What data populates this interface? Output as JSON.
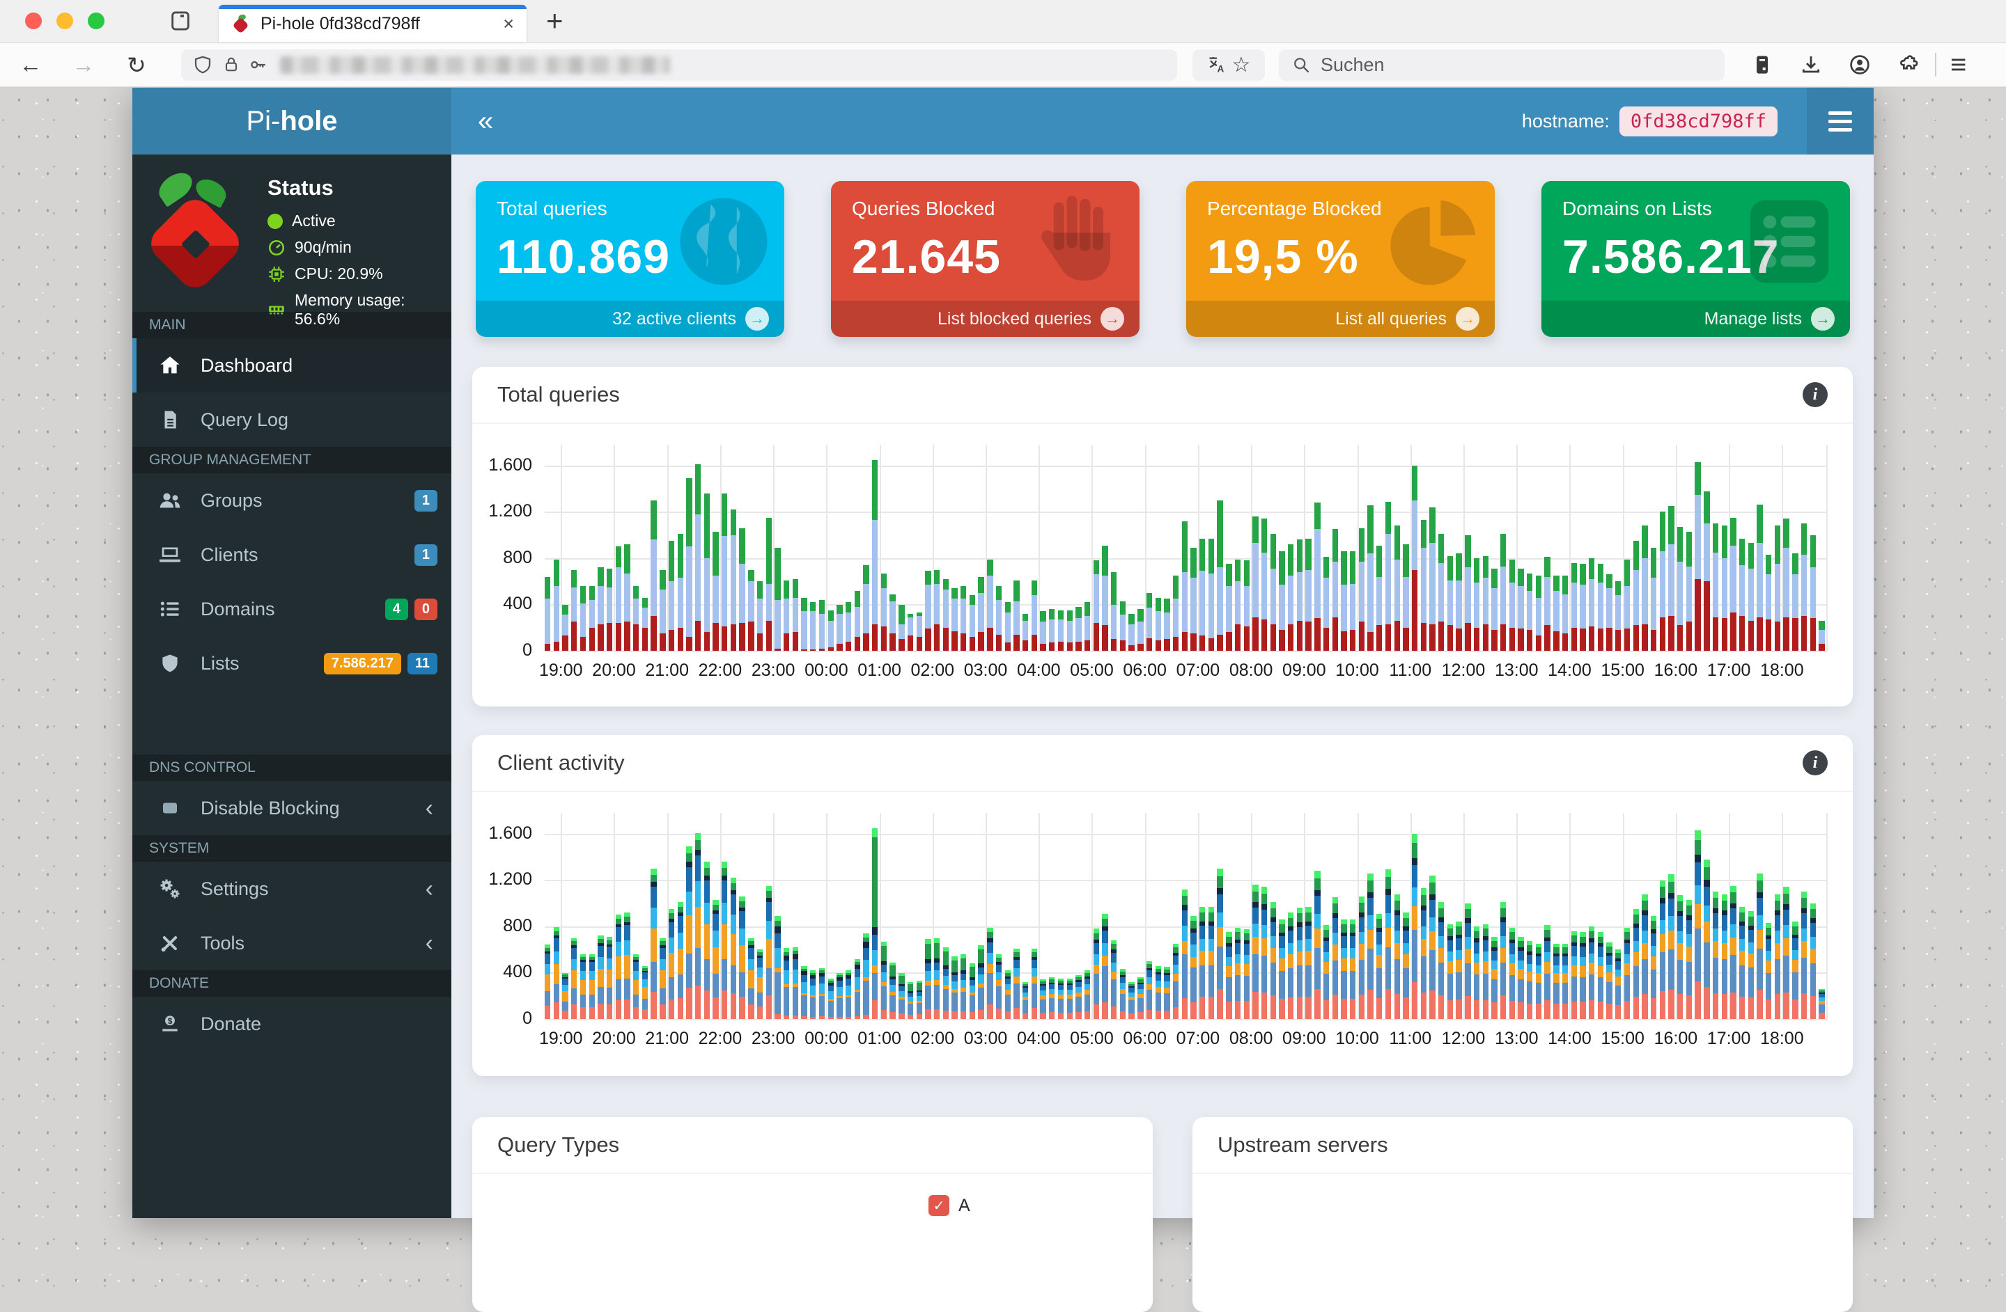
{
  "browser": {
    "tab_title": "Pi-hole 0fd38cd798ff",
    "search_placeholder": "Suchen",
    "icons": {
      "back": "←",
      "forward": "→",
      "reload": "↻",
      "star": "☆",
      "close": "×",
      "new_tab": "+",
      "menu": "≡"
    }
  },
  "header": {
    "brand_light": "Pi-",
    "brand_bold": "hole",
    "collapse": "«",
    "hostname_label": "hostname:",
    "hostname": "0fd38cd798ff"
  },
  "sidebar": {
    "status_title": "Status",
    "status_items": [
      {
        "label": "Active"
      },
      {
        "label": "90q/min"
      },
      {
        "label": "CPU: 20.9%"
      },
      {
        "label": "Memory usage: 56.6%"
      }
    ],
    "headers": {
      "main": "MAIN",
      "group": "GROUP MANAGEMENT",
      "dns": "DNS CONTROL",
      "system": "SYSTEM",
      "donate": "DONATE"
    },
    "items": {
      "dashboard": "Dashboard",
      "querylog": "Query Log",
      "groups": "Groups",
      "clients": "Clients",
      "domains": "Domains",
      "lists": "Lists",
      "disable": "Disable Blocking",
      "settings": "Settings",
      "tools": "Tools",
      "donate": "Donate"
    },
    "badges": {
      "groups": "1",
      "clients": "1",
      "domains_ok": "4",
      "domains_zero": "0",
      "lists_count": "7.586.217",
      "lists_num": "11"
    },
    "chevron": "‹",
    "badge_colors": {
      "blue": "#3c8dbc",
      "green": "#00a65a",
      "red": "#dd4b39",
      "orange": "#f39c12"
    }
  },
  "cards": [
    {
      "title": "Total queries",
      "value": "110.869",
      "footer": "32 active clients",
      "color": "#00c0ef"
    },
    {
      "title": "Queries Blocked",
      "value": "21.645",
      "footer": "List blocked queries",
      "color": "#dd4b39"
    },
    {
      "title": "Percentage Blocked",
      "value": "19,5 %",
      "footer": "List all queries",
      "color": "#f39c12"
    },
    {
      "title": "Domains on Lists",
      "value": "7.586.217",
      "footer": "Manage lists",
      "color": "#00a65a"
    }
  ],
  "card_arrow": "→",
  "panels": {
    "total_queries": {
      "title": "Total queries",
      "info": "i"
    },
    "client_activity": {
      "title": "Client activity",
      "info": "i"
    },
    "query_types": {
      "title": "Query Types",
      "legend": [
        "A"
      ]
    },
    "upstream": {
      "title": "Upstream servers"
    }
  },
  "chart_data": [
    {
      "type": "bar",
      "stacked": true,
      "mount": "total-queries-chart",
      "title": "Total queries",
      "interval_minutes": 10,
      "axis_max": 1780,
      "yticks": [
        0,
        400,
        800,
        1200,
        1600
      ],
      "ytick_labels": [
        "0",
        "400",
        "800",
        "1.200",
        "1.600"
      ],
      "x_labels": [
        "19:00",
        "20:00",
        "21:00",
        "22:00",
        "23:00",
        "00:00",
        "01:00",
        "02:00",
        "03:00",
        "04:00",
        "05:00",
        "06:00",
        "07:00",
        "08:00",
        "09:00",
        "10:00",
        "11:00",
        "12:00",
        "13:00",
        "14:00",
        "15:00",
        "16:00",
        "17:00",
        "18:00"
      ],
      "first_bar_hour": 2,
      "bars_per_hour": 6,
      "series_colors": [
        "#b01d1d",
        "#a5c2ef",
        "#25a546"
      ],
      "bars": [
        [
          60,
          390,
          190
        ],
        [
          80,
          480,
          230
        ],
        [
          130,
          180,
          90
        ],
        [
          250,
          300,
          150
        ],
        [
          120,
          290,
          150
        ],
        [
          200,
          240,
          120
        ],
        [
          230,
          330,
          160
        ],
        [
          240,
          310,
          160
        ],
        [
          240,
          480,
          180
        ],
        [
          250,
          420,
          250
        ],
        [
          230,
          220,
          110
        ],
        [
          200,
          170,
          90
        ],
        [
          300,
          660,
          340
        ],
        [
          150,
          380,
          170
        ],
        [
          180,
          420,
          350
        ],
        [
          200,
          430,
          380
        ],
        [
          120,
          780,
          590
        ],
        [
          260,
          920,
          430
        ],
        [
          160,
          640,
          560
        ],
        [
          240,
          410,
          380
        ],
        [
          210,
          780,
          370
        ],
        [
          230,
          770,
          220
        ],
        [
          240,
          510,
          310
        ],
        [
          250,
          350,
          100
        ],
        [
          150,
          300,
          150
        ],
        [
          260,
          320,
          570
        ],
        [
          20,
          420,
          450
        ],
        [
          150,
          300,
          160
        ],
        [
          160,
          300,
          160
        ],
        [
          10,
          330,
          120
        ],
        [
          10,
          330,
          80
        ],
        [
          20,
          300,
          120
        ],
        [
          30,
          230,
          90
        ],
        [
          60,
          260,
          80
        ],
        [
          80,
          250,
          90
        ],
        [
          120,
          260,
          140
        ],
        [
          150,
          430,
          160
        ],
        [
          230,
          900,
          520
        ],
        [
          210,
          330,
          130
        ],
        [
          150,
          280,
          60
        ],
        [
          100,
          130,
          170
        ],
        [
          130,
          160,
          30
        ],
        [
          120,
          180,
          30
        ],
        [
          190,
          380,
          120
        ],
        [
          230,
          350,
          120
        ],
        [
          200,
          330,
          90
        ],
        [
          170,
          280,
          90
        ],
        [
          150,
          300,
          110
        ],
        [
          120,
          280,
          80
        ],
        [
          160,
          340,
          140
        ],
        [
          200,
          450,
          140
        ],
        [
          140,
          300,
          120
        ],
        [
          70,
          260,
          90
        ],
        [
          140,
          290,
          180
        ],
        [
          90,
          170,
          60
        ],
        [
          140,
          340,
          130
        ],
        [
          60,
          190,
          90
        ],
        [
          70,
          200,
          90
        ],
        [
          80,
          190,
          80
        ],
        [
          70,
          190,
          90
        ],
        [
          80,
          200,
          100
        ],
        [
          90,
          210,
          120
        ],
        [
          240,
          420,
          120
        ],
        [
          220,
          430,
          260
        ],
        [
          100,
          300,
          280
        ],
        [
          90,
          220,
          120
        ],
        [
          50,
          180,
          90
        ],
        [
          60,
          190,
          110
        ],
        [
          110,
          260,
          130
        ],
        [
          90,
          250,
          120
        ],
        [
          100,
          230,
          120
        ],
        [
          120,
          330,
          200
        ],
        [
          160,
          520,
          440
        ],
        [
          150,
          480,
          260
        ],
        [
          130,
          560,
          280
        ],
        [
          110,
          560,
          300
        ],
        [
          140,
          580,
          580
        ],
        [
          160,
          400,
          190
        ],
        [
          230,
          370,
          190
        ],
        [
          210,
          350,
          220
        ],
        [
          290,
          640,
          230
        ],
        [
          270,
          580,
          290
        ],
        [
          230,
          480,
          300
        ],
        [
          180,
          390,
          290
        ],
        [
          230,
          420,
          270
        ],
        [
          260,
          420,
          280
        ],
        [
          250,
          450,
          270
        ],
        [
          280,
          770,
          230
        ],
        [
          200,
          430,
          180
        ],
        [
          290,
          480,
          280
        ],
        [
          170,
          400,
          290
        ],
        [
          180,
          400,
          280
        ],
        [
          250,
          520,
          290
        ],
        [
          160,
          680,
          420
        ],
        [
          220,
          420,
          270
        ],
        [
          230,
          780,
          280
        ],
        [
          260,
          530,
          290
        ],
        [
          200,
          440,
          280
        ],
        [
          700,
          600,
          300
        ],
        [
          240,
          650,
          240
        ],
        [
          230,
          700,
          310
        ],
        [
          250,
          510,
          250
        ],
        [
          220,
          390,
          210
        ],
        [
          190,
          420,
          230
        ],
        [
          240,
          480,
          280
        ],
        [
          200,
          390,
          210
        ],
        [
          230,
          400,
          190
        ],
        [
          180,
          360,
          170
        ],
        [
          230,
          500,
          280
        ],
        [
          200,
          390,
          200
        ],
        [
          190,
          370,
          150
        ],
        [
          180,
          340,
          150
        ],
        [
          130,
          330,
          190
        ],
        [
          220,
          420,
          170
        ],
        [
          170,
          350,
          130
        ],
        [
          150,
          340,
          160
        ],
        [
          200,
          390,
          170
        ],
        [
          190,
          380,
          180
        ],
        [
          210,
          410,
          180
        ],
        [
          190,
          400,
          160
        ],
        [
          200,
          340,
          120
        ],
        [
          180,
          300,
          120
        ],
        [
          190,
          370,
          230
        ],
        [
          220,
          480,
          250
        ],
        [
          230,
          570,
          280
        ],
        [
          180,
          450,
          260
        ],
        [
          290,
          570,
          340
        ],
        [
          300,
          620,
          330
        ],
        [
          220,
          550,
          300
        ],
        [
          250,
          480,
          300
        ],
        [
          620,
          730,
          280
        ],
        [
          600,
          500,
          280
        ],
        [
          290,
          560,
          250
        ],
        [
          280,
          520,
          280
        ],
        [
          330,
          580,
          240
        ],
        [
          300,
          440,
          230
        ],
        [
          260,
          450,
          220
        ],
        [
          290,
          640,
          330
        ],
        [
          270,
          390,
          170
        ],
        [
          250,
          500,
          330
        ],
        [
          290,
          600,
          250
        ],
        [
          280,
          380,
          180
        ],
        [
          300,
          530,
          270
        ],
        [
          280,
          440,
          280
        ],
        [
          60,
          120,
          80
        ]
      ]
    },
    {
      "type": "bar",
      "stacked": true,
      "mount": "client-activity-chart",
      "title": "Client activity",
      "interval_minutes": 10,
      "axis_max": 1780,
      "yticks": [
        0,
        400,
        800,
        1200,
        1600
      ],
      "ytick_labels": [
        "0",
        "400",
        "800",
        "1.200",
        "1.600"
      ],
      "x_labels": [
        "19:00",
        "20:00",
        "21:00",
        "22:00",
        "23:00",
        "00:00",
        "01:00",
        "02:00",
        "03:00",
        "04:00",
        "05:00",
        "06:00",
        "07:00",
        "08:00",
        "09:00",
        "10:00",
        "11:00",
        "12:00",
        "13:00",
        "14:00",
        "15:00",
        "16:00",
        "17:00",
        "18:00"
      ],
      "first_bar_hour": 2,
      "bars_per_hour": 6,
      "series_colors": [
        "#f07364",
        "#5b8fc3",
        "#f2a024",
        "#31b5ea",
        "#1c6cb0",
        "#14273f",
        "#259a4e",
        "#45ee69"
      ],
      "derive": {
        "from": 0,
        "profiles": [
          [
            0.18,
            0.2,
            0.22,
            0.14,
            0.14,
            0.03,
            0.05,
            0.04
          ],
          [
            0.05,
            0.4,
            0.04,
            0.2,
            0.14,
            0.07,
            0.05,
            0.05
          ],
          [
            0.1,
            0.14,
            0.04,
            0.08,
            0.08,
            0.04,
            0.47,
            0.05
          ],
          [
            0.12,
            0.3,
            0.06,
            0.12,
            0.1,
            0.05,
            0.19,
            0.06
          ],
          [
            0.16,
            0.34,
            0.1,
            0.12,
            0.12,
            0.04,
            0.07,
            0.05
          ],
          [
            0.2,
            0.28,
            0.13,
            0.1,
            0.12,
            0.04,
            0.08,
            0.05
          ]
        ],
        "map": [
          {
            "until": 25,
            "p": 0
          },
          {
            "until": 36,
            "p": 1
          },
          {
            "until": 37,
            "p": 2
          },
          {
            "until": 49,
            "p": 3
          },
          {
            "until": 73,
            "p": 4
          },
          {
            "until": 144,
            "p": 5
          }
        ]
      }
    }
  ]
}
